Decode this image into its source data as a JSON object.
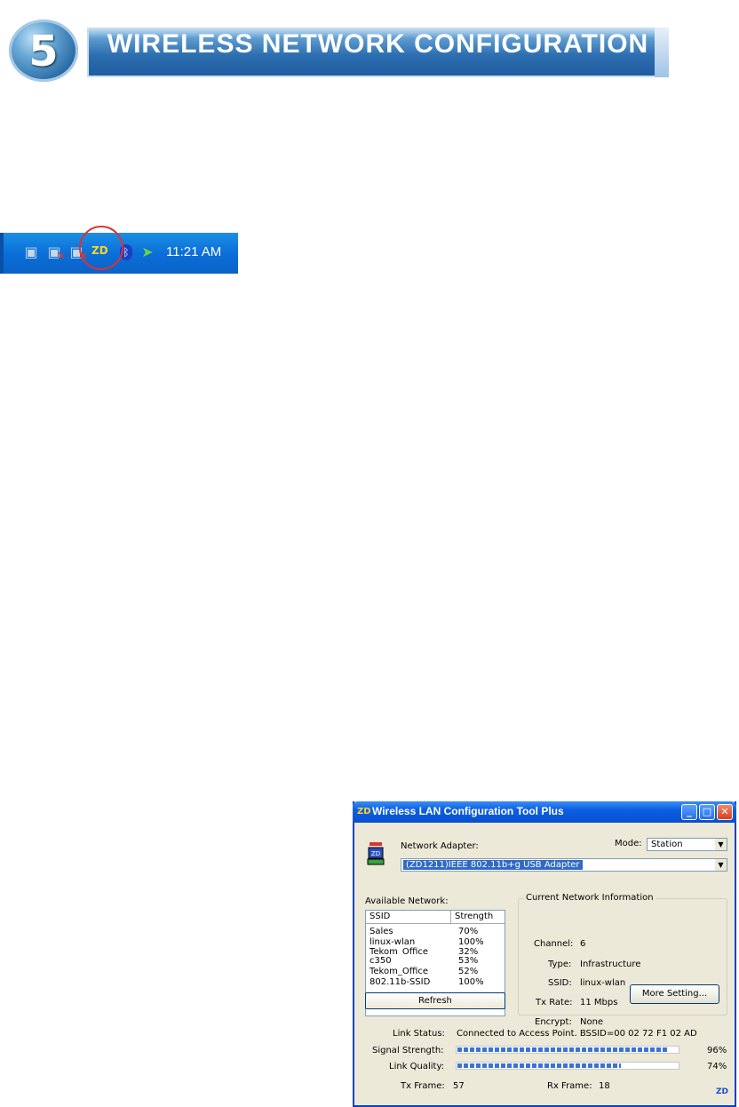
{
  "header": {
    "step_number": "5",
    "title": "WIRELESS NETWORK CONFIGURATION"
  },
  "tray": {
    "time": "11:21 AM",
    "icons": [
      "network-icon",
      "network-disconnected-icon",
      "network-disconnected-icon",
      "zd-wireless-utility-icon",
      "bluetooth-icon",
      "safely-remove-hardware-icon"
    ]
  },
  "window": {
    "title": "Wireless LAN Configuration Tool Plus",
    "controls": {
      "minimize": "_",
      "maximize": "□",
      "close": "✕"
    },
    "adapter_label": "Network Adapter:",
    "adapter_value": "(ZD1211)IEEE 802.11b+g USB Adapter",
    "mode_label": "Mode:",
    "mode_value": "Station",
    "available_label": "Available Network:",
    "columns": [
      "SSID",
      "Strength"
    ],
    "networks": [
      {
        "ssid": "Sales",
        "strength": "70%"
      },
      {
        "ssid": "linux-wlan",
        "strength": "100%"
      },
      {
        "ssid": "Tekom_Office",
        "strength": "32%"
      },
      {
        "ssid": "c350",
        "strength": "53%"
      },
      {
        "ssid": "Tekom_Office",
        "strength": "52%"
      },
      {
        "ssid": "802.11b-SSID",
        "strength": "100%"
      }
    ],
    "refresh_label": "Refresh",
    "current_info": {
      "title": "Current Network Information",
      "channel_label": "Channel:",
      "channel": "6",
      "type_label": "Type:",
      "type": "Infrastructure",
      "ssid_label": "SSID:",
      "ssid": "linux-wlan",
      "txrate_label": "Tx Rate:",
      "txrate": "11 Mbps",
      "encrypt_label": "Encrypt:",
      "encrypt": "None"
    },
    "more_setting_label": "More Setting...",
    "link_status_label": "Link Status:",
    "link_status": "Connected to Access Point. BSSID=00 02 72 F1 02 AD",
    "signal_label": "Signal Strength:",
    "signal_value": 0.96,
    "signal_text": "96%",
    "quality_label": "Link Quality:",
    "quality_value": 0.74,
    "quality_text": "74%",
    "txframe_label": "Tx Frame:",
    "txframe": "57",
    "rxframe_label": "Rx Frame:",
    "rxframe": "18"
  }
}
